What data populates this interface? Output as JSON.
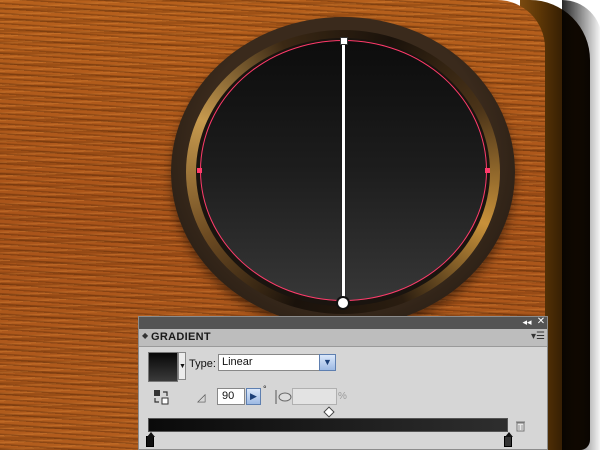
{
  "panel": {
    "tab_arrows": "◆",
    "title": "GRADIENT",
    "collapse_icon": "◂◂",
    "close_icon": "✕",
    "menu_icon": "▾☰",
    "type_label": "Type:",
    "type_value": "Linear",
    "angle_value": "90",
    "degree_symbol": "°",
    "aspect_value": "",
    "percent_symbol": "%",
    "swatch_colors": [
      "#080808",
      "#3a3a3a"
    ],
    "gradient_stops": [
      {
        "color": "#111111",
        "location": 0
      },
      {
        "color": "#333333",
        "location": 100
      }
    ],
    "midpoint_location": 50
  },
  "icons": {
    "reverse": "reverse-gradient-icon",
    "angle": "angle-icon",
    "aspect": "aspect-ratio-icon",
    "trash": "trash-icon"
  },
  "colors": {
    "selection_path": "#ff3a6a",
    "wood": "#b25d1d",
    "panel_bg": "#d6d6d6",
    "titlebar": "#545454"
  }
}
